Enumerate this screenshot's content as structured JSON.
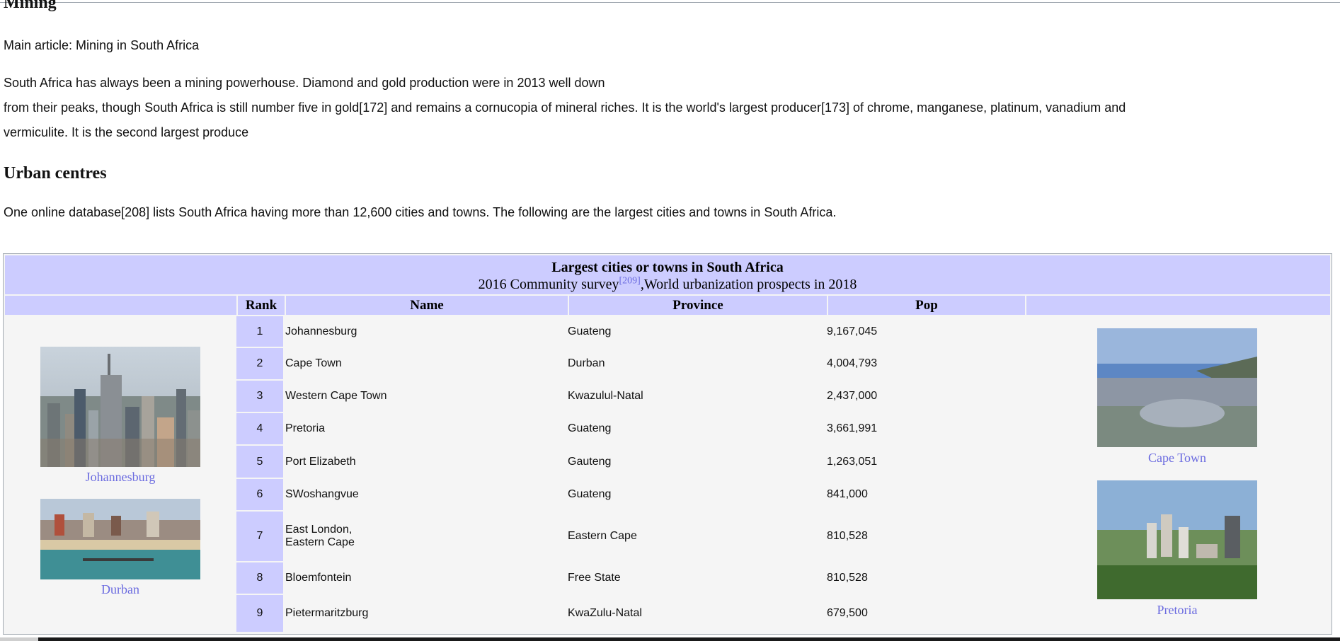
{
  "article": {
    "mining_heading": "Mining",
    "mining_main": "Main article: Mining in South Africa",
    "mining_line1": "South Africa has always been a mining powerhouse. Diamond and gold production were in 2013 well down",
    "mining_line2": "from their peaks, though South Africa is still number five in gold[172] and remains a cornucopia of mineral riches. It is the world's largest producer[173] of chrome, manganese, platinum, vanadium and",
    "mining_line3": "vermiculite. It is the second largest produce",
    "urban_heading": "Urban centres",
    "urban_text": "One online database[208] lists South Africa having more than 12,600 cities and towns. The following are the largest cities and towns in South Africa."
  },
  "table": {
    "title": "Largest cities or towns in South Africa",
    "subtitle_a": "2016 Community survey",
    "subtitle_ref": "[209]",
    "subtitle_b": ",World urbanization prospects in 2018",
    "headers": {
      "rank": "Rank",
      "name": "Name",
      "province": "Province",
      "pop": "Pop"
    },
    "rows": [
      {
        "rank": "1",
        "name": "Johannesburg",
        "province": "Guateng",
        "pop": "9,167,045"
      },
      {
        "rank": "2",
        "name": "Cape Town",
        "province": "Durban",
        "pop": "4,004,793"
      },
      {
        "rank": "3",
        "name": "Western Cape Town",
        "province": "Kwazulul-Natal",
        "pop": "2,437,000"
      },
      {
        "rank": "4",
        "name": "Pretoria",
        "province": "Guateng",
        "pop": "3,661,991"
      },
      {
        "rank": "5",
        "name": "Port Elizabeth",
        "province": "Gauteng",
        "pop": "1,263,051"
      },
      {
        "rank": "6",
        "name": "SWoshangvue",
        "province": "Guateng",
        "pop": "841,000"
      },
      {
        "rank": "7",
        "name": "East London,",
        "name2": "Eastern Cape",
        "province": "Eastern Cape",
        "pop": "810,528"
      },
      {
        "rank": "8",
        "name": "Bloemfontein",
        "province": "Free State",
        "pop": "810,528"
      },
      {
        "rank": "9",
        "name": "Pietermaritzburg",
        "province": "KwaZulu-Natal",
        "pop": "679,500"
      }
    ],
    "images": {
      "johannesburg": "Johannesburg",
      "durban": "Durban",
      "cape_town": "Cape Town",
      "pretoria": "Pretoria"
    }
  },
  "colors": {
    "header_bg": "#ccccff",
    "link": "#6b6be0",
    "table_bg": "#f5f5f5"
  }
}
